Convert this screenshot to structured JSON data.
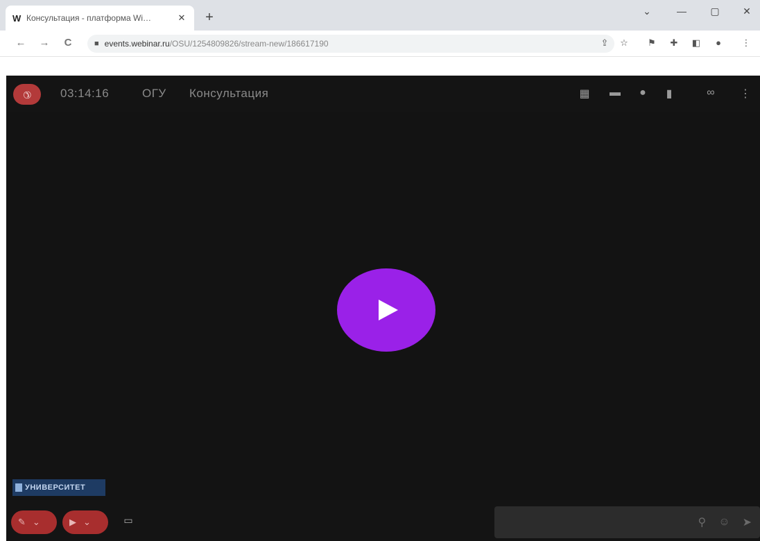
{
  "browser": {
    "tab": {
      "favicon": "W",
      "title": "Консультация - платформа Wi… ",
      "close": "✕"
    },
    "new_tab": "+",
    "window": {
      "chevron": "⌄",
      "minimize": "—",
      "restore": "▢",
      "close": "✕"
    },
    "nav": {
      "back": "←",
      "forward": "→",
      "reload": "C"
    },
    "url": {
      "host": "events.webinar.ru",
      "path": "/OSU/1254809826/stream-new/186617190"
    },
    "toolbar_icons": {
      "share": "⇪",
      "star": "☆",
      "ext1": "⚑",
      "puzzle": "✚",
      "sidepanel": "◧",
      "profile": "●",
      "menu": "⋮"
    }
  },
  "app": {
    "header": {
      "timer": "03:14:16",
      "org": "ОГУ",
      "title": "Консультация",
      "icons": {
        "layout": "▦",
        "chat": "▬",
        "people": "●",
        "files": "▮",
        "link": "∞",
        "more": "⋮"
      }
    },
    "player": {
      "state": "paused",
      "action_icon": "play-icon"
    },
    "logo_text": "УНИВЕРСИТЕТ",
    "controls": {
      "mic_icon": "✎",
      "cam_icon": "▶",
      "dropdown": "⌄",
      "extra_icon": "▭"
    },
    "chat": {
      "placeholder": "",
      "icons": {
        "attach": "⚲",
        "emoji": "☺",
        "send": "➤"
      }
    }
  },
  "colors": {
    "accent": "#9a21e8",
    "danger": "#b33a3a",
    "stage": "#131313"
  }
}
